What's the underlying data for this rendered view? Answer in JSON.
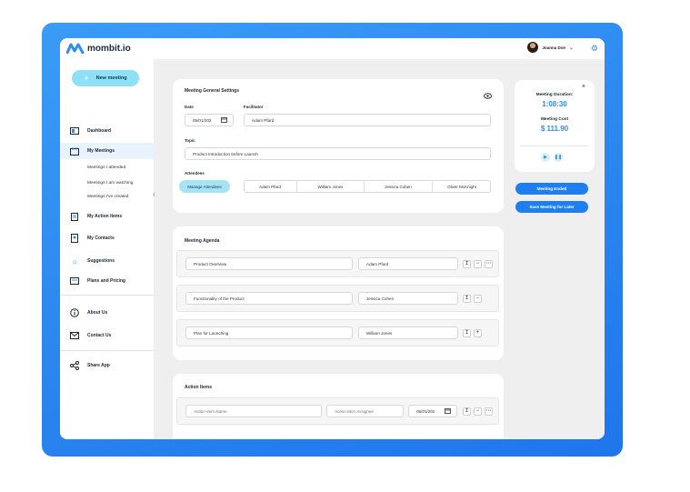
{
  "app": {
    "logo_text": "mombit.io"
  },
  "user": {
    "name": "Joanna Doe"
  },
  "sidebar": {
    "new_meeting": "New meeting",
    "items": [
      {
        "label": "Dashboard",
        "icon": "dashboard-icon"
      },
      {
        "label": "My Meetings",
        "icon": "meetings-icon"
      },
      {
        "label": "My Action Items",
        "icon": "clipboard-icon"
      },
      {
        "label": "My Contacts",
        "icon": "contacts-icon"
      },
      {
        "label": "Suggestions",
        "icon": "bulb-icon"
      },
      {
        "label": "Plans and Pricing",
        "icon": "pricing-icon"
      },
      {
        "label": "About Us",
        "icon": "info-icon"
      },
      {
        "label": "Contact Us",
        "icon": "mail-icon"
      },
      {
        "label": "Share App",
        "icon": "share-icon"
      }
    ],
    "sub_items": [
      "Meetings I attended",
      "Meetings I am watching",
      "Meetings I've created"
    ]
  },
  "settings": {
    "title": "Meeting General Settings",
    "date_label": "Date",
    "date_value": "05/01/202",
    "facilitator_label": "Facilitator",
    "facilitator_value": "Adam Pfard",
    "topic_label": "Topic",
    "topic_value": "Product Introduction before Launch",
    "attendees_label": "Attendees",
    "manage_attendees": "Manage Attendees",
    "attendees": [
      "Adam Pfard",
      "William Jones",
      "Jessica Cohen",
      "Oliver McKnight"
    ]
  },
  "agenda": {
    "title": "Meeting Agenda",
    "items": [
      {
        "topic": "Product Overview",
        "owner": "Adam Pfard"
      },
      {
        "topic": "Functionality of the Product",
        "owner": "Jessica Cohen"
      },
      {
        "topic": "Plan for Launching",
        "owner": "William Jones"
      }
    ]
  },
  "actions": {
    "title": "Action Items",
    "name_placeholder": "Action Item Name",
    "assignee_placeholder": "Action Item Assignee",
    "date_value": "05/01/202"
  },
  "timer": {
    "duration_label": "Meeting Duration:",
    "duration_value": "1:08:30",
    "cost_label": "Meeting Cost",
    "cost_value": "$ 111.90",
    "ended_button": "Meeting Ended",
    "save_button": "Save Meeting for Later"
  },
  "colors": {
    "accent": "#2f8cf0",
    "frame": "#2c87f0",
    "new_button": "#8ee0f6"
  }
}
